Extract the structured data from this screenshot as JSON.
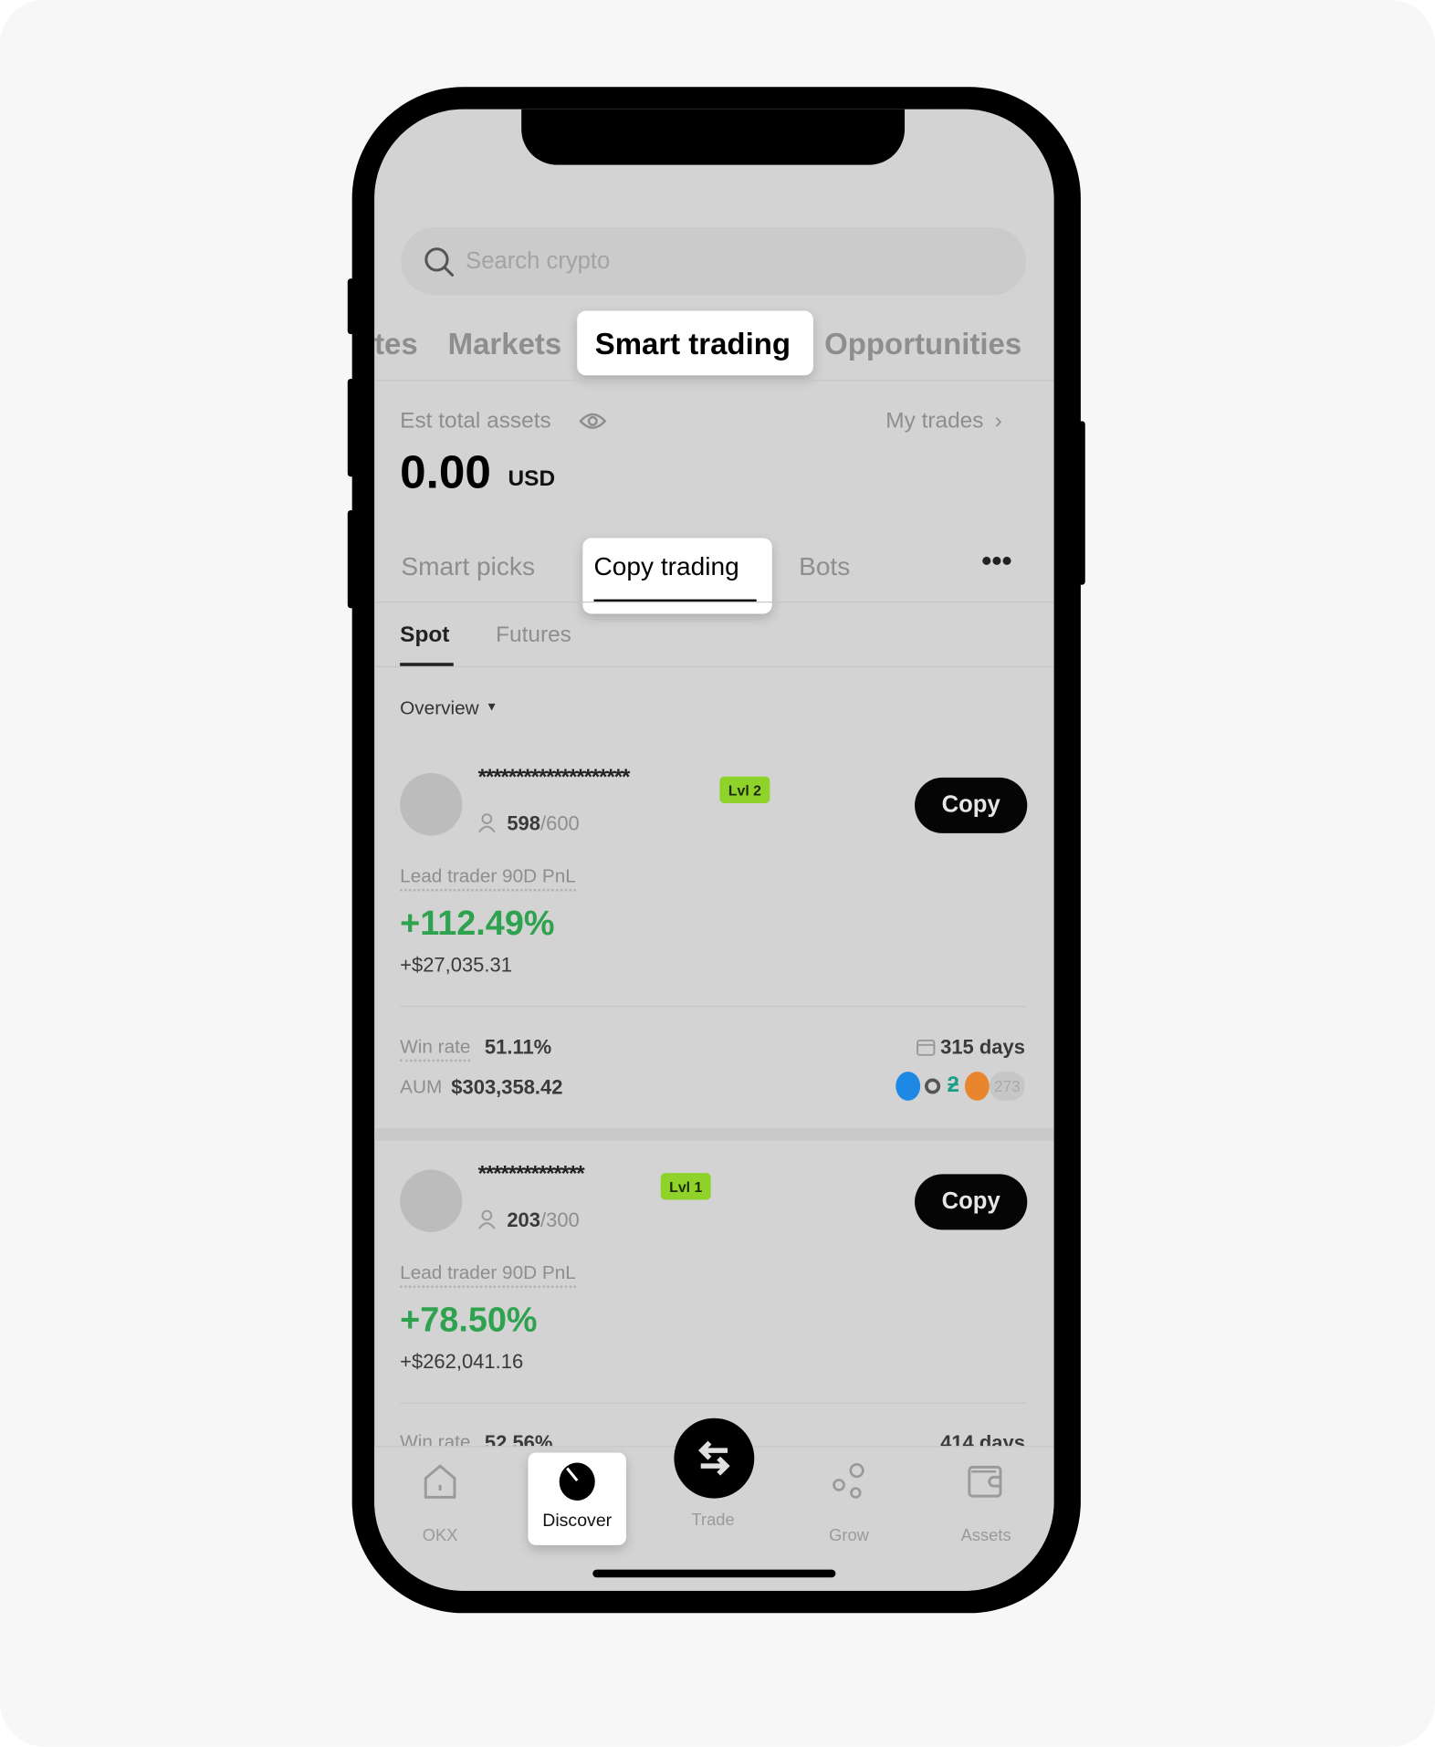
{
  "search": {
    "placeholder": "Search crypto",
    "icon": "search-icon"
  },
  "top_tabs": [
    {
      "label": "tes"
    },
    {
      "label": "Markets"
    },
    {
      "label": "Smart trading",
      "active": true
    },
    {
      "label": "Opportunities"
    }
  ],
  "assets": {
    "label": "Est total assets",
    "value": "0.00",
    "currency": "USD",
    "my_trades": "My trades"
  },
  "sub_tabs": [
    {
      "label": "Smart picks"
    },
    {
      "label": "Copy trading",
      "active": true
    },
    {
      "label": "Bots"
    }
  ],
  "market_tabs": [
    {
      "label": "Spot",
      "active": true
    },
    {
      "label": "Futures"
    }
  ],
  "filter": {
    "label": "Overview"
  },
  "traders": [
    {
      "name": "********************",
      "level": "Lvl 2",
      "copiers": "598",
      "capacity": "/600",
      "copy_label": "Copy",
      "pnl_label": "Lead trader 90D PnL",
      "pnl_pct": "+112.49%",
      "pnl_usd": "+$27,035.31",
      "win_rate_label": "Win rate",
      "win_rate": "51.11%",
      "days": "315 days",
      "aum_label": "AUM",
      "aum": "$303,358.42",
      "coin_count": "273"
    },
    {
      "name": "**************",
      "level": "Lvl 1",
      "copiers": "203",
      "capacity": "/300",
      "copy_label": "Copy",
      "pnl_label": "Lead trader 90D PnL",
      "pnl_pct": "+78.50%",
      "pnl_usd": "+$262,041.16",
      "win_rate_label": "Win rate",
      "win_rate": "52.56%",
      "days": "414 days"
    }
  ],
  "bottom_nav": [
    {
      "label": "OKX",
      "icon": "home-icon"
    },
    {
      "label": "Discover",
      "icon": "compass-icon",
      "active": true
    },
    {
      "label": "Trade",
      "icon": "swap-icon"
    },
    {
      "label": "Grow",
      "icon": "grow-icon"
    },
    {
      "label": "Assets",
      "icon": "wallet-icon"
    }
  ],
  "colors": {
    "profit": "#2fa24f",
    "level_badge": "#8fd32a",
    "copy_button": "#050505"
  }
}
